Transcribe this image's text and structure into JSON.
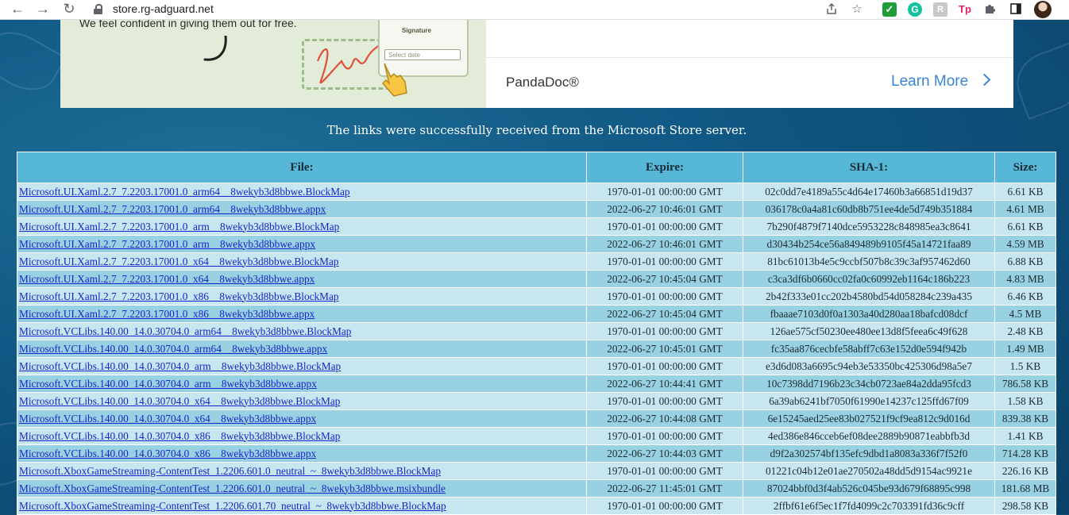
{
  "browser": {
    "url": "store.rg-adguard.net",
    "nav_back": "←",
    "nav_forward": "→",
    "nav_reload": "↻",
    "ext_grammarly": "G",
    "ext_grey": "R",
    "ext_tp": "Tp"
  },
  "ad": {
    "tagline": "We feel confident in giving them out for free.",
    "signature_label": "Signature",
    "date_placeholder": "Select date",
    "brand": "PandaDoc®",
    "cta": "Learn More"
  },
  "message": "The links were successfully received from the Microsoft Store server.",
  "table": {
    "headers": {
      "file": "File:",
      "expire": "Expire:",
      "sha1": "SHA-1:",
      "size": "Size:"
    },
    "rows": [
      {
        "file": "Microsoft.UI.Xaml.2.7_7.2203.17001.0_arm64__8wekyb3d8bbwe.BlockMap",
        "expire": "1970-01-01 00:00:00 GMT",
        "sha1": "02c0dd7e4189a55c4d64e17460b3a66851d19d37",
        "size": "6.61 KB"
      },
      {
        "file": "Microsoft.UI.Xaml.2.7_7.2203.17001.0_arm64__8wekyb3d8bbwe.appx",
        "expire": "2022-06-27 10:46:01 GMT",
        "sha1": "036178c0a4a81c60db8b751ee4de5d749b351884",
        "size": "4.61 MB"
      },
      {
        "file": "Microsoft.UI.Xaml.2.7_7.2203.17001.0_arm__8wekyb3d8bbwe.BlockMap",
        "expire": "1970-01-01 00:00:00 GMT",
        "sha1": "7b290f4879f7140dce5953228c848985ea3c8641",
        "size": "6.61 KB"
      },
      {
        "file": "Microsoft.UI.Xaml.2.7_7.2203.17001.0_arm__8wekyb3d8bbwe.appx",
        "expire": "2022-06-27 10:46:01 GMT",
        "sha1": "d30434b254ce56a849489b9105f45a14721faa89",
        "size": "4.59 MB"
      },
      {
        "file": "Microsoft.UI.Xaml.2.7_7.2203.17001.0_x64__8wekyb3d8bbwe.BlockMap",
        "expire": "1970-01-01 00:00:00 GMT",
        "sha1": "81bc61013b4e5c9ccbf507b8c39c3af957462d60",
        "size": "6.88 KB"
      },
      {
        "file": "Microsoft.UI.Xaml.2.7_7.2203.17001.0_x64__8wekyb3d8bbwe.appx",
        "expire": "2022-06-27 10:45:04 GMT",
        "sha1": "c3ca3df6b0660cc02fa0c60992eb1164c186b223",
        "size": "4.83 MB"
      },
      {
        "file": "Microsoft.UI.Xaml.2.7_7.2203.17001.0_x86__8wekyb3d8bbwe.BlockMap",
        "expire": "1970-01-01 00:00:00 GMT",
        "sha1": "2b42f333e01cc202b4580bd54d058284c239a435",
        "size": "6.46 KB"
      },
      {
        "file": "Microsoft.UI.Xaml.2.7_7.2203.17001.0_x86__8wekyb3d8bbwe.appx",
        "expire": "2022-06-27 10:45:04 GMT",
        "sha1": "fbaaae7103d0f0a1303a40d280aa18bafcd08dcf",
        "size": "4.5 MB"
      },
      {
        "file": "Microsoft.VCLibs.140.00_14.0.30704.0_arm64__8wekyb3d8bbwe.BlockMap",
        "expire": "1970-01-01 00:00:00 GMT",
        "sha1": "126ae575cf50230ee480ee13d8f5feea6c49f628",
        "size": "2.48 KB"
      },
      {
        "file": "Microsoft.VCLibs.140.00_14.0.30704.0_arm64__8wekyb3d8bbwe.appx",
        "expire": "2022-06-27 10:45:01 GMT",
        "sha1": "fc35aa876cecbfe58abff7c63e152d0e594f942b",
        "size": "1.49 MB"
      },
      {
        "file": "Microsoft.VCLibs.140.00_14.0.30704.0_arm__8wekyb3d8bbwe.BlockMap",
        "expire": "1970-01-01 00:00:00 GMT",
        "sha1": "e3d6d083a6695c94eb3e53350bc425306d98a5e7",
        "size": "1.5 KB"
      },
      {
        "file": "Microsoft.VCLibs.140.00_14.0.30704.0_arm__8wekyb3d8bbwe.appx",
        "expire": "2022-06-27 10:44:41 GMT",
        "sha1": "10c7398dd7196b23c34cb0723ae84a2dda95fcd3",
        "size": "786.58 KB"
      },
      {
        "file": "Microsoft.VCLibs.140.00_14.0.30704.0_x64__8wekyb3d8bbwe.BlockMap",
        "expire": "1970-01-01 00:00:00 GMT",
        "sha1": "6a39ab6241bf7050f61990e14237c125ffd67f09",
        "size": "1.58 KB"
      },
      {
        "file": "Microsoft.VCLibs.140.00_14.0.30704.0_x64__8wekyb3d8bbwe.appx",
        "expire": "2022-06-27 10:44:08 GMT",
        "sha1": "6e15245aed25ee83b027521f9cf9ea812c9d016d",
        "size": "839.38 KB"
      },
      {
        "file": "Microsoft.VCLibs.140.00_14.0.30704.0_x86__8wekyb3d8bbwe.BlockMap",
        "expire": "1970-01-01 00:00:00 GMT",
        "sha1": "4ed386e846cceb6ef08dee2889b90871eabbfb3d",
        "size": "1.41 KB"
      },
      {
        "file": "Microsoft.VCLibs.140.00_14.0.30704.0_x86__8wekyb3d8bbwe.appx",
        "expire": "2022-06-27 10:44:03 GMT",
        "sha1": "d9f2a302574bf135efc9dbd1a8083a336f7f52f0",
        "size": "714.28 KB"
      },
      {
        "file": "Microsoft.XboxGameStreaming-ContentTest_1.2206.601.0_neutral_~_8wekyb3d8bbwe.BlockMap",
        "expire": "1970-01-01 00:00:00 GMT",
        "sha1": "01221c04b12e01ae270502a48dd5d9154ac9921e",
        "size": "226.16 KB"
      },
      {
        "file": "Microsoft.XboxGameStreaming-ContentTest_1.2206.601.0_neutral_~_8wekyb3d8bbwe.msixbundle",
        "expire": "2022-06-27 11:45:01 GMT",
        "sha1": "87024bbf0d3f4ab526c045be93d679f68895c998",
        "size": "181.68 MB"
      },
      {
        "file": "Microsoft.XboxGameStreaming-ContentTest_1.2206.601.70_neutral_~_8wekyb3d8bbwe.BlockMap",
        "expire": "1970-01-01 00:00:00 GMT",
        "sha1": "2ffbf61e6f5ec1f7fd4099c2c703391fd36c9cff",
        "size": "298.58 KB"
      }
    ]
  }
}
